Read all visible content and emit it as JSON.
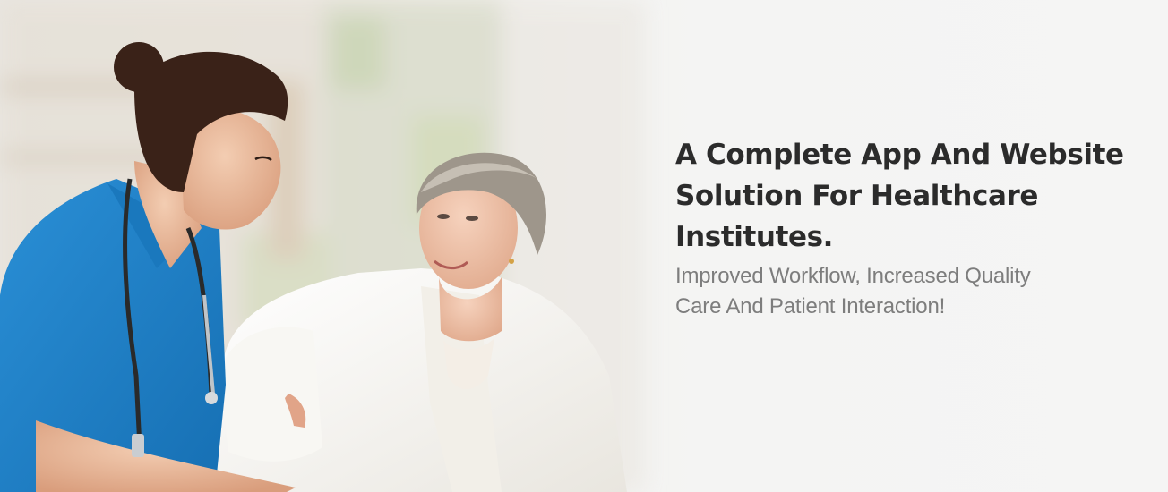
{
  "hero": {
    "headline_lines": [
      "A Complete App And Website",
      "Solution For Healthcare",
      "Institutes."
    ],
    "subheadline_lines": [
      "Improved Workflow, Increased Quality",
      "Care And Patient Interaction!"
    ],
    "photo_subject": "nurse-and-elderly-patient-photo",
    "colors": {
      "headline": "#2b2b2b",
      "subheadline": "#7d7d7d",
      "scrubs": "#1e7fc7",
      "robe": "#f7f5f0",
      "background": "#f4f4f3"
    }
  }
}
